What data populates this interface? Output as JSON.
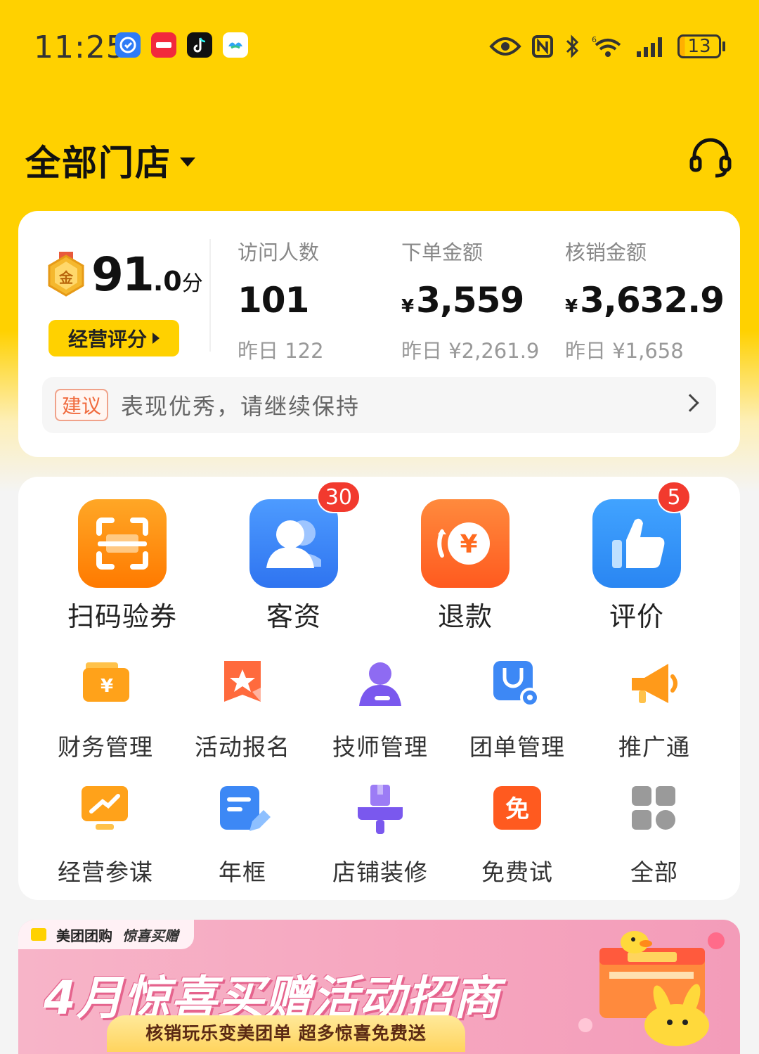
{
  "status_bar": {
    "time": "11:25",
    "apps": [
      "app-shield-icon",
      "xiaohongshu-icon",
      "tiktok-icon",
      "cloud-app-icon"
    ],
    "indicators": [
      "eye-icon",
      "nfc-icon",
      "bluetooth-icon",
      "wifi-icon",
      "signal-icon"
    ],
    "battery_level": "13"
  },
  "header": {
    "store_label": "全部门店",
    "support_icon": "headset-icon"
  },
  "metrics": {
    "score_main": "91",
    "score_decimal": ".0",
    "score_unit": "分",
    "rating_button": "经营评分",
    "items": [
      {
        "label": "访问人数",
        "value": "101",
        "currency": "",
        "prev": "昨日 122"
      },
      {
        "label": "下单金额",
        "value": "3,559",
        "currency": "¥",
        "prev": "昨日 ¥2,261.9"
      },
      {
        "label": "核销金额",
        "value": "3,632.9",
        "currency": "¥",
        "prev": "昨日 ¥1,658"
      }
    ],
    "suggest_tag": "建议",
    "suggest_text": "表现优秀，请继续保持"
  },
  "main_tools": [
    {
      "label": "扫码验券",
      "icon": "scan-icon",
      "badge": ""
    },
    {
      "label": "客资",
      "icon": "customer-icon",
      "badge": "30"
    },
    {
      "label": "退款",
      "icon": "refund-icon",
      "badge": ""
    },
    {
      "label": "评价",
      "icon": "thumbs-up-icon",
      "badge": "5"
    }
  ],
  "sub_tools": [
    {
      "label": "财务管理",
      "icon": "wallet-icon"
    },
    {
      "label": "活动报名",
      "icon": "star-flag-icon"
    },
    {
      "label": "技师管理",
      "icon": "person-icon"
    },
    {
      "label": "团单管理",
      "icon": "bag-gear-icon"
    },
    {
      "label": "推广通",
      "icon": "megaphone-icon"
    },
    {
      "label": "经营参谋",
      "icon": "trend-icon"
    },
    {
      "label": "年框",
      "icon": "form-edit-icon"
    },
    {
      "label": "店铺装修",
      "icon": "paint-roller-icon"
    },
    {
      "label": "免费试",
      "icon": "free-trial-icon"
    },
    {
      "label": "全部",
      "icon": "grid-icon"
    }
  ],
  "banner": {
    "brand": "美团团购",
    "campaign": "惊喜买赠",
    "title": "4月惊喜买赠活动招商",
    "subtitle": "核销玩乐变美团单 超多惊喜免费送"
  },
  "colors": {
    "brand_yellow": "#FFD100",
    "badge_red": "#F23A2E",
    "suggest_orange": "#F06B3E"
  }
}
